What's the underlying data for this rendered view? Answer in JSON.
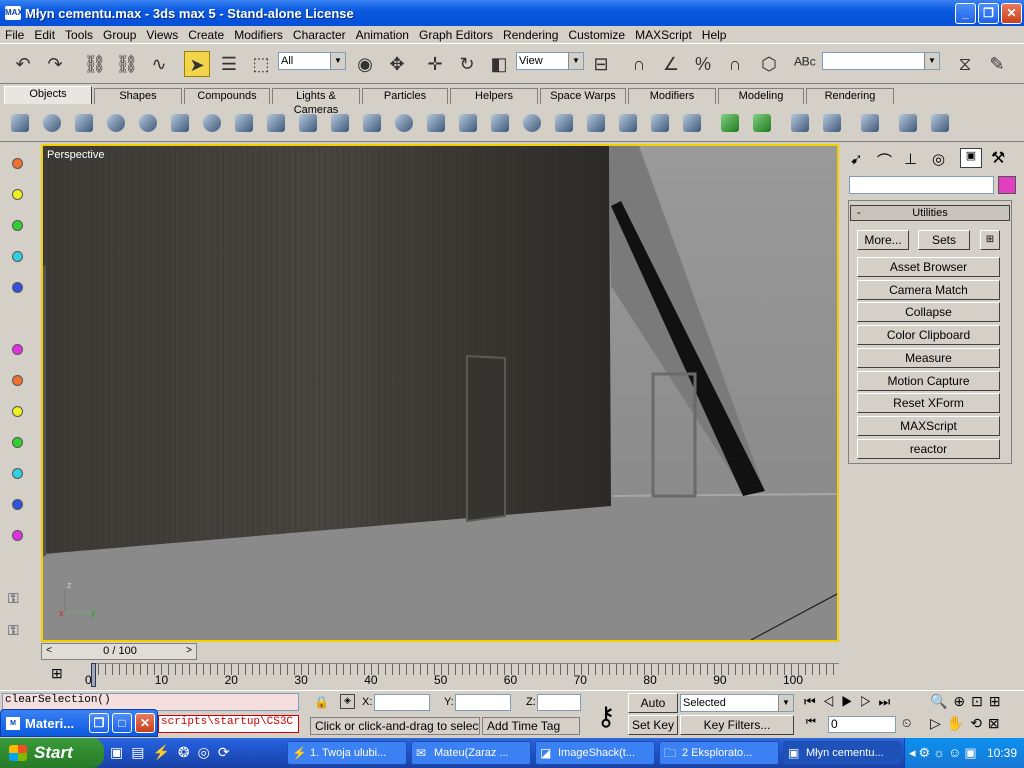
{
  "window": {
    "title": "Młyn cementu.max - 3ds max 5 - Stand-alone License"
  },
  "menu": [
    "File",
    "Edit",
    "Tools",
    "Group",
    "Views",
    "Create",
    "Modifiers",
    "Character",
    "Animation",
    "Graph Editors",
    "Rendering",
    "Customize",
    "MAXScript",
    "Help"
  ],
  "toolbar": {
    "selection_filter": "All",
    "ref_coord": "View",
    "named_selection": ""
  },
  "tabs": [
    "Objects",
    "Shapes",
    "Compounds",
    "Lights & Cameras",
    "Particles",
    "Helpers",
    "Space Warps",
    "Modifiers",
    "Modeling",
    "Rendering"
  ],
  "viewport": {
    "label": "Perspective"
  },
  "panel": {
    "rollout_title": "Utilities",
    "rollout_toggle": "-",
    "more": "More...",
    "sets": "Sets",
    "buttons": [
      "Asset Browser",
      "Camera Match",
      "Collapse",
      "Color Clipboard",
      "Measure",
      "Motion Capture",
      "Reset XForm",
      "MAXScript",
      "reactor"
    ]
  },
  "timeline": {
    "position": "0 / 100",
    "ticks": [
      "0",
      "10",
      "20",
      "30",
      "40",
      "50",
      "60",
      "70",
      "80",
      "90",
      "100"
    ],
    "frame_progress": 0
  },
  "status": {
    "script_line1": "clearSelection()",
    "script_line2": "scripts\\startup\\CS3C",
    "prompt": "Click or click-and-drag to select ob",
    "add_time_tag": "Add Time Tag",
    "x_label": "X:",
    "y_label": "Y:",
    "z_label": "Z:",
    "auto_key": "Auto Key",
    "set_key": "Set Key",
    "key_mode": "Selected",
    "key_filters": "Key Filters...",
    "frame": "0"
  },
  "floating": {
    "title": "Materi..."
  },
  "taskbar": {
    "start": "Start",
    "tasks": [
      "1. Twoja ulubi...",
      "Mateu(Zaraz ...",
      "ImageShack(t...",
      "2 Eksplorato...",
      "Młyn cementu..."
    ],
    "clock": "10:39"
  },
  "colors": {
    "viewport_border": "#f2d000",
    "title_blue": "#0a5ae0",
    "start_green": "#2f8a2f"
  }
}
